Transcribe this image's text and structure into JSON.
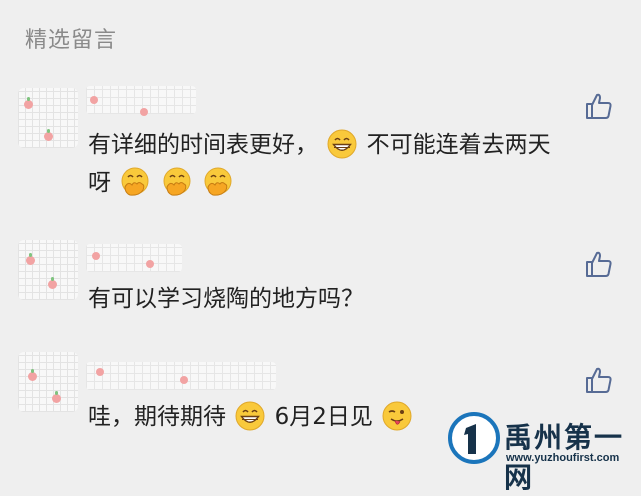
{
  "section": {
    "title": "精选留言"
  },
  "comments": [
    {
      "text_parts": [
        "有详细的时间表更好，",
        "不可能连着去两天",
        "呀"
      ],
      "emojis": [
        "grin-emoji",
        "hand-over-mouth-emoji"
      ]
    },
    {
      "text_parts": [
        "有可以学习烧陶的地方吗？"
      ]
    },
    {
      "text_parts": [
        "哇，期待期待",
        "6月2日见"
      ],
      "emojis": [
        "grin-emoji",
        "wink-tongue-emoji"
      ]
    }
  ],
  "like_icon": "thumbs-up-outline-icon",
  "watermark": {
    "brand": "禹州第一网",
    "url": "www.yuzhoufirst.com"
  },
  "colors": {
    "background": "#efefef",
    "text": "#222222",
    "section_title": "#8a8a8a",
    "icon": "#576b95"
  }
}
